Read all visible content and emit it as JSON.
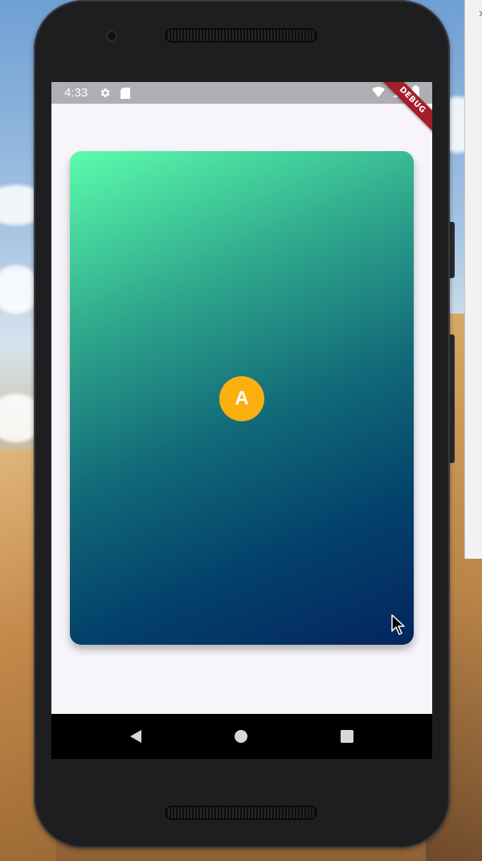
{
  "status_bar": {
    "time": "4:33",
    "icons": [
      "settings-icon",
      "sd-card-icon",
      "wifi-icon",
      "signal-icon",
      "battery-icon"
    ]
  },
  "debug_banner": "DEBUG",
  "card": {
    "avatar_letter": "A",
    "gradient_start": "#5cfcac",
    "gradient_end": "#04255e",
    "avatar_color": "#fcb00f"
  },
  "navigation": {
    "buttons": [
      "back",
      "home",
      "recents"
    ]
  }
}
